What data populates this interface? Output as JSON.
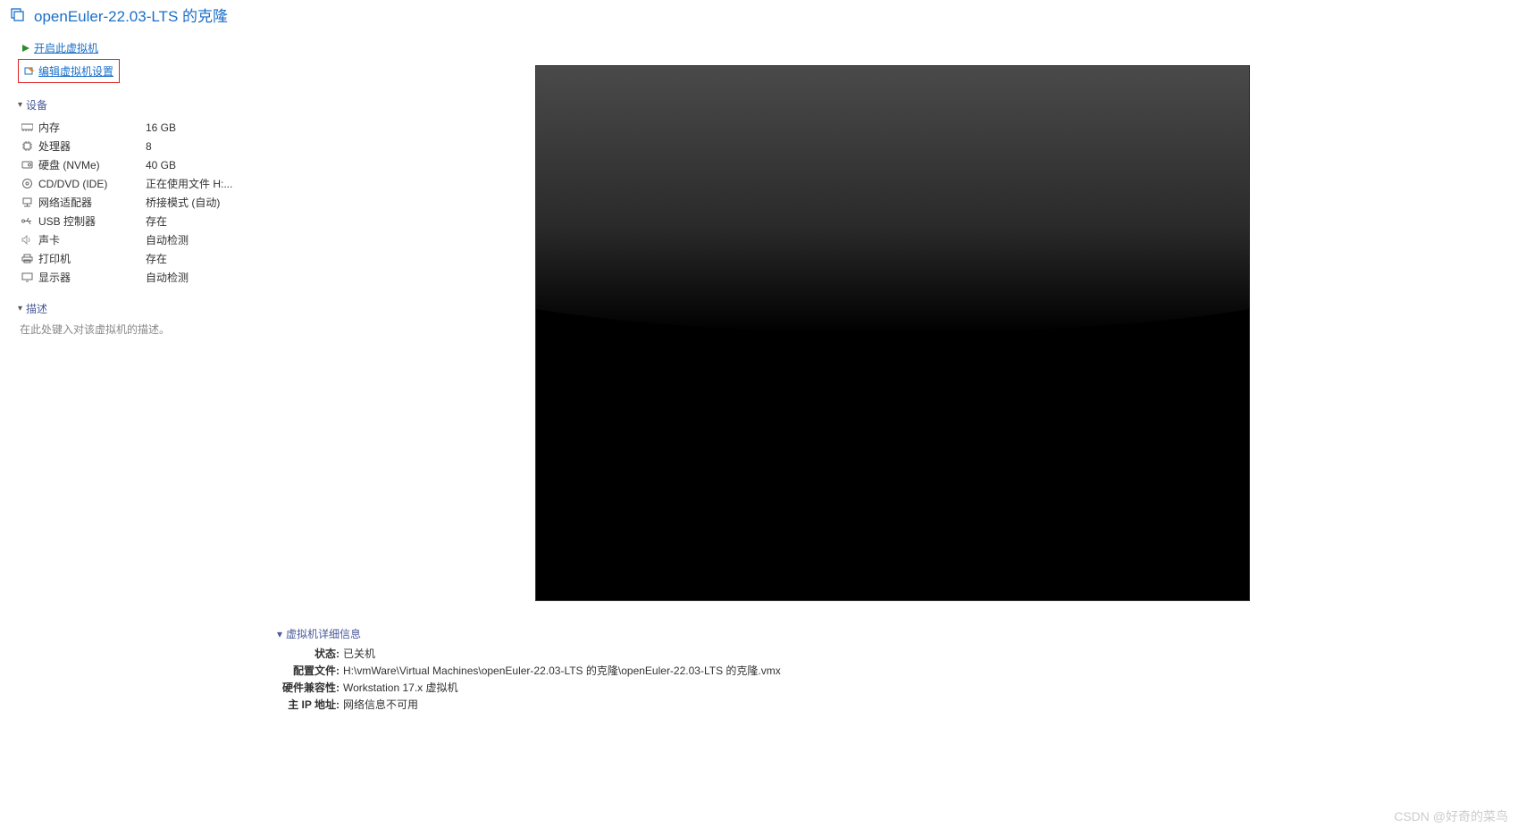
{
  "header": {
    "title": "openEuler-22.03-LTS 的克隆"
  },
  "actions": {
    "power_on": "开启此虚拟机",
    "edit_settings": "编辑虚拟机设置"
  },
  "sections": {
    "devices": "设备",
    "description": "描述",
    "details": "虚拟机详细信息"
  },
  "devices": [
    {
      "icon": "memory-icon",
      "label": "内存",
      "value": "16 GB"
    },
    {
      "icon": "cpu-icon",
      "label": "处理器",
      "value": "8"
    },
    {
      "icon": "disk-icon",
      "label": "硬盘 (NVMe)",
      "value": "40 GB"
    },
    {
      "icon": "cd-icon",
      "label": "CD/DVD (IDE)",
      "value": "正在使用文件 H:..."
    },
    {
      "icon": "network-icon",
      "label": "网络适配器",
      "value": "桥接模式 (自动)"
    },
    {
      "icon": "usb-icon",
      "label": "USB 控制器",
      "value": "存在"
    },
    {
      "icon": "sound-icon",
      "label": "声卡",
      "value": "自动检测"
    },
    {
      "icon": "printer-icon",
      "label": "打印机",
      "value": "存在"
    },
    {
      "icon": "display-icon",
      "label": "显示器",
      "value": "自动检测"
    }
  ],
  "description_placeholder": "在此处键入对该虚拟机的描述。",
  "details": [
    {
      "label": "状态:",
      "value": "已关机"
    },
    {
      "label": "配置文件:",
      "value": "H:\\vmWare\\Virtual Machines\\openEuler-22.03-LTS 的克隆\\openEuler-22.03-LTS 的克隆.vmx"
    },
    {
      "label": "硬件兼容性:",
      "value": "Workstation 17.x 虚拟机"
    },
    {
      "label": "主 IP 地址:",
      "value": "网络信息不可用"
    }
  ],
  "watermark": "CSDN @好奇的菜鸟"
}
